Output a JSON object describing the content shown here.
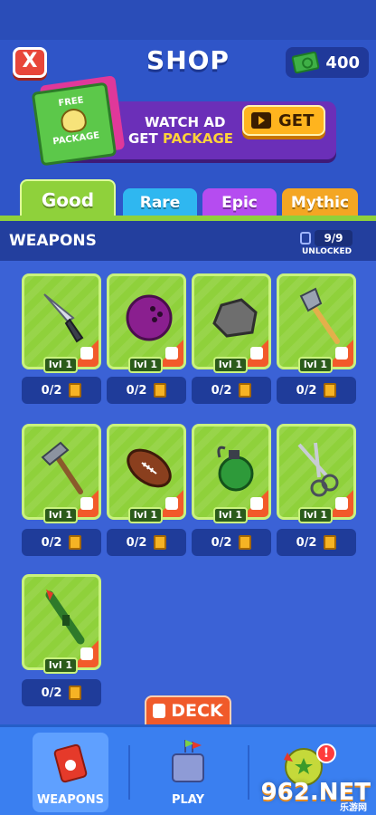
{
  "header": {
    "close_label": "X",
    "title": "SHOP",
    "currency_amount": "400",
    "currency_icon": "cash-icon"
  },
  "promo": {
    "package_label_1": "FREE",
    "package_label_2": "PACKAGE",
    "line1": "WATCH AD",
    "line2_prefix": "GET",
    "line2_highlight": "PACKAGE",
    "get_button_label": "GET"
  },
  "tabs": [
    {
      "label": "Good",
      "color": "#8fd13b",
      "active": true
    },
    {
      "label": "Rare",
      "color": "#2fb7f0",
      "active": false
    },
    {
      "label": "Epic",
      "color": "#b54cf0",
      "active": false
    },
    {
      "label": "Mythic",
      "color": "#f4a623",
      "active": false
    }
  ],
  "section": {
    "title": "WEAPONS",
    "unlocked_count": "9/9",
    "unlocked_label": "UNLOCKED"
  },
  "weapons": [
    {
      "name": "knife",
      "level": "lvl 1",
      "cards": "0/2"
    },
    {
      "name": "bowling-ball",
      "level": "lvl 1",
      "cards": "0/2"
    },
    {
      "name": "rock",
      "level": "lvl 1",
      "cards": "0/2"
    },
    {
      "name": "axe",
      "level": "lvl 1",
      "cards": "0/2"
    },
    {
      "name": "hammer",
      "level": "lvl 1",
      "cards": "0/2"
    },
    {
      "name": "football",
      "level": "lvl 1",
      "cards": "0/2"
    },
    {
      "name": "grenade",
      "level": "lvl 1",
      "cards": "0/2"
    },
    {
      "name": "scissors",
      "level": "lvl 1",
      "cards": "0/2"
    },
    {
      "name": "rocket-launcher",
      "level": "lvl 1",
      "cards": "0/2"
    }
  ],
  "deck_label": "DECK",
  "nav": {
    "weapons_label": "WEAPONS",
    "play_label": "PLAY",
    "alert_label": "!"
  },
  "watermark": {
    "text": "962.NET",
    "sub": "乐游网"
  }
}
